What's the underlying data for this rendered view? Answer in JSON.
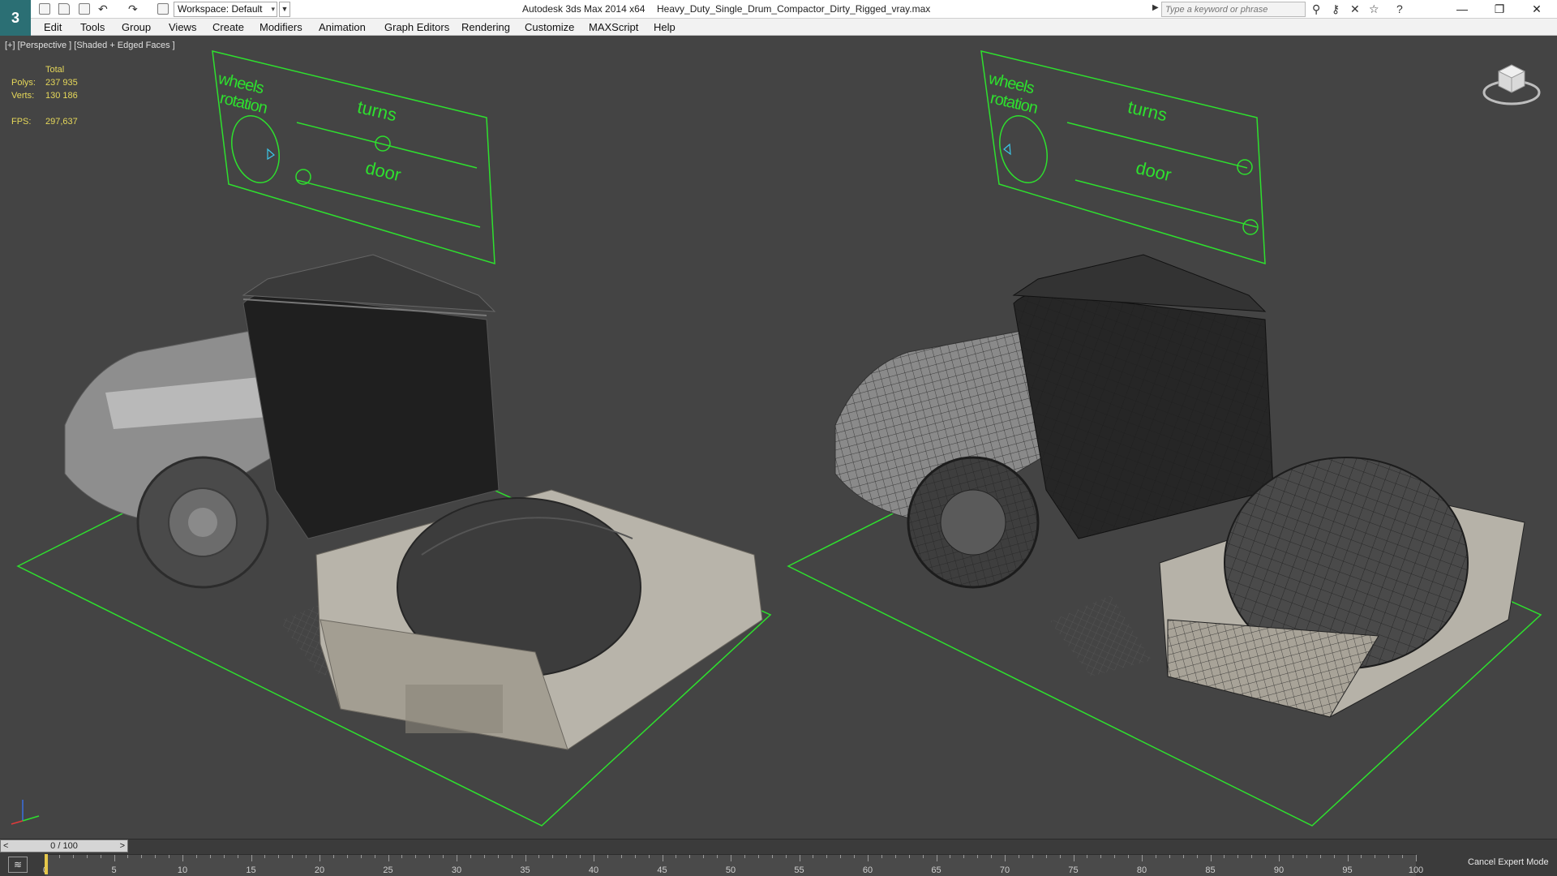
{
  "titlebar": {
    "app_icon_label": "3",
    "workspace": "Workspace: Default",
    "app_title": "Autodesk 3ds Max  2014 x64",
    "file_title": "Heavy_Duty_Single_Drum_Compactor_Dirty_Rigged_vray.max",
    "search_placeholder": "Type a keyword or phrase",
    "icons": [
      "new-file-icon",
      "open-file-icon",
      "save-icon",
      "undo-icon",
      "redo-icon",
      "project-folder-icon",
      "search-arrow-icon",
      "binoculars-icon",
      "key-icon",
      "exchange-icon",
      "star-icon",
      "help-icon",
      "minimize-icon",
      "restore-icon",
      "close-icon"
    ]
  },
  "menubar": {
    "items": [
      "Edit",
      "Tools",
      "Group",
      "Views",
      "Create",
      "Modifiers",
      "Animation",
      "Graph Editors",
      "Rendering",
      "Customize",
      "MAXScript",
      "Help"
    ]
  },
  "viewport": {
    "label": "[+] [Perspective ] [Shaded + Edged Faces ]",
    "stats": {
      "header": "Total",
      "polys_label": "Polys:",
      "polys_value": "237 935",
      "verts_label": "Verts:",
      "verts_value": "130 186",
      "fps_label": "FPS:",
      "fps_value": "297,637"
    },
    "rig_panels": [
      {
        "wheels": "wheels",
        "rotation": "rotation",
        "turns": "turns",
        "door": "door"
      },
      {
        "wheels": "wheels",
        "rotation": "rotation",
        "turns": "turns",
        "door": "door"
      }
    ],
    "colors": {
      "background": "#444444",
      "rig_green": "#2ee02e",
      "stats_yellow": "#e6d85a"
    }
  },
  "timeline": {
    "slider_text": "0 / 100",
    "prev": "<",
    "next": ">",
    "ticks": [
      "0",
      "5",
      "10",
      "15",
      "20",
      "25",
      "30",
      "35",
      "40",
      "45",
      "50",
      "55",
      "60",
      "65",
      "70",
      "75",
      "80",
      "85",
      "90",
      "95",
      "100"
    ],
    "expert_button": "Cancel Expert Mode"
  }
}
